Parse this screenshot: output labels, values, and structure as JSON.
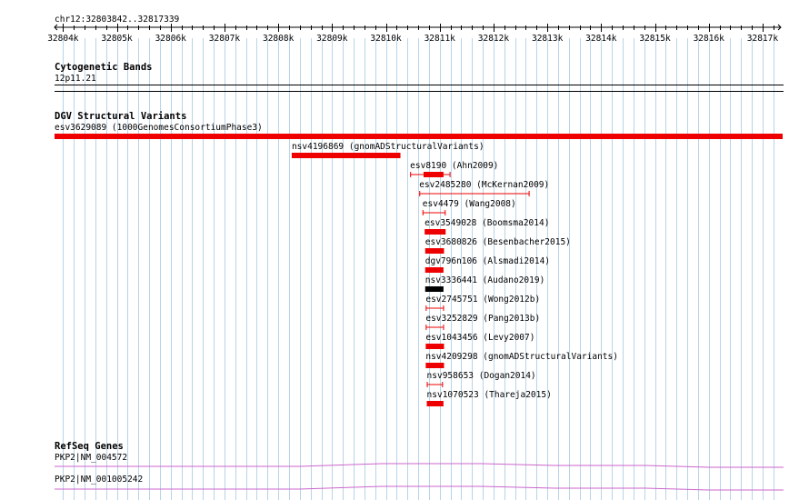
{
  "location": "chr12:32803842..32817339",
  "view": {
    "start": 32803842,
    "end": 32817339
  },
  "ruler": {
    "major_ticks": [
      32804000,
      32805000,
      32806000,
      32807000,
      32808000,
      32809000,
      32810000,
      32811000,
      32812000,
      32813000,
      32814000,
      32815000,
      32816000,
      32817000
    ],
    "labels": [
      "32804k",
      "32805k",
      "32806k",
      "32807k",
      "32808k",
      "32809k",
      "32810k",
      "32811k",
      "32812k",
      "32813k",
      "32814k",
      "32815k",
      "32816k",
      "32817k"
    ],
    "minor_step": 200
  },
  "tracks": {
    "cytoband": {
      "title": "Cytogenetic Bands",
      "band_label": "12p11.21"
    },
    "dgv": {
      "title": "DGV Structural Variants",
      "features": [
        {
          "label": "esv3629089 (1000GenomesConsortiumPhase3)",
          "start": 32803842,
          "end": 32817339,
          "style": "bar",
          "color": "#ee0000",
          "row": 0
        },
        {
          "label": "nsv4196869 (gnomADStructuralVariants)",
          "start": 32808250,
          "end": 32810270,
          "style": "bar",
          "color": "#ee0000",
          "row": 1
        },
        {
          "label": "esv8190 (Ahn2009)",
          "start": 32810450,
          "end": 32811200,
          "style": "bar-whisker",
          "bar_start": 32810700,
          "bar_end": 32811070,
          "color": "#ee0000",
          "row": 2
        },
        {
          "label": "esv2485280 (McKernan2009)",
          "start": 32810620,
          "end": 32812670,
          "style": "whisker",
          "color": "#ee0000",
          "row": 3
        },
        {
          "label": "esv4479 (Wang2008)",
          "start": 32810680,
          "end": 32811110,
          "style": "whisker",
          "color": "#ee0000",
          "row": 4
        },
        {
          "label": "esv3549028 (Boomsma2014)",
          "start": 32810720,
          "end": 32811110,
          "style": "bar",
          "color": "#ee0000",
          "row": 5
        },
        {
          "label": "esv3680826 (Besenbacher2015)",
          "start": 32810730,
          "end": 32811080,
          "style": "bar",
          "color": "#ee0000",
          "row": 6
        },
        {
          "label": "dgv796n106 (Alsmadi2014)",
          "start": 32810730,
          "end": 32811070,
          "style": "bar",
          "color": "#ee0000",
          "row": 7
        },
        {
          "label": "nsv3336441 (Audano2019)",
          "start": 32810730,
          "end": 32811070,
          "style": "bar",
          "color": "#000000",
          "row": 8
        },
        {
          "label": "esv2745751 (Wong2012b)",
          "start": 32810740,
          "end": 32811080,
          "style": "whisker",
          "color": "#ee0000",
          "row": 9
        },
        {
          "label": "esv3252829 (Pang2013b)",
          "start": 32810740,
          "end": 32811080,
          "style": "whisker",
          "color": "#ee0000",
          "row": 10
        },
        {
          "label": "esv1043456 (Levy2007)",
          "start": 32810740,
          "end": 32811080,
          "style": "bar",
          "color": "#ee0000",
          "row": 11
        },
        {
          "label": "nsv4209298 (gnomADStructuralVariants)",
          "start": 32810740,
          "end": 32811080,
          "style": "bar",
          "color": "#ee0000",
          "row": 12
        },
        {
          "label": "nsv958653 (Dogan2014)",
          "start": 32810760,
          "end": 32811060,
          "style": "whisker",
          "color": "#ee0000",
          "row": 13
        },
        {
          "label": "nsv1070523 (Thareja2015)",
          "start": 32810760,
          "end": 32811070,
          "style": "bar",
          "color": "#ee0000",
          "row": 14
        }
      ]
    },
    "refseq": {
      "title": "RefSeq Genes",
      "genes": [
        {
          "label": "PKP2|NM_004572"
        },
        {
          "label": "PKP2|NM_001005242"
        }
      ],
      "color": "#cc66cc"
    }
  },
  "colors": {
    "grid": "#b8d4e8",
    "variant_red": "#ee0000",
    "gene_magenta": "#cc66cc"
  }
}
